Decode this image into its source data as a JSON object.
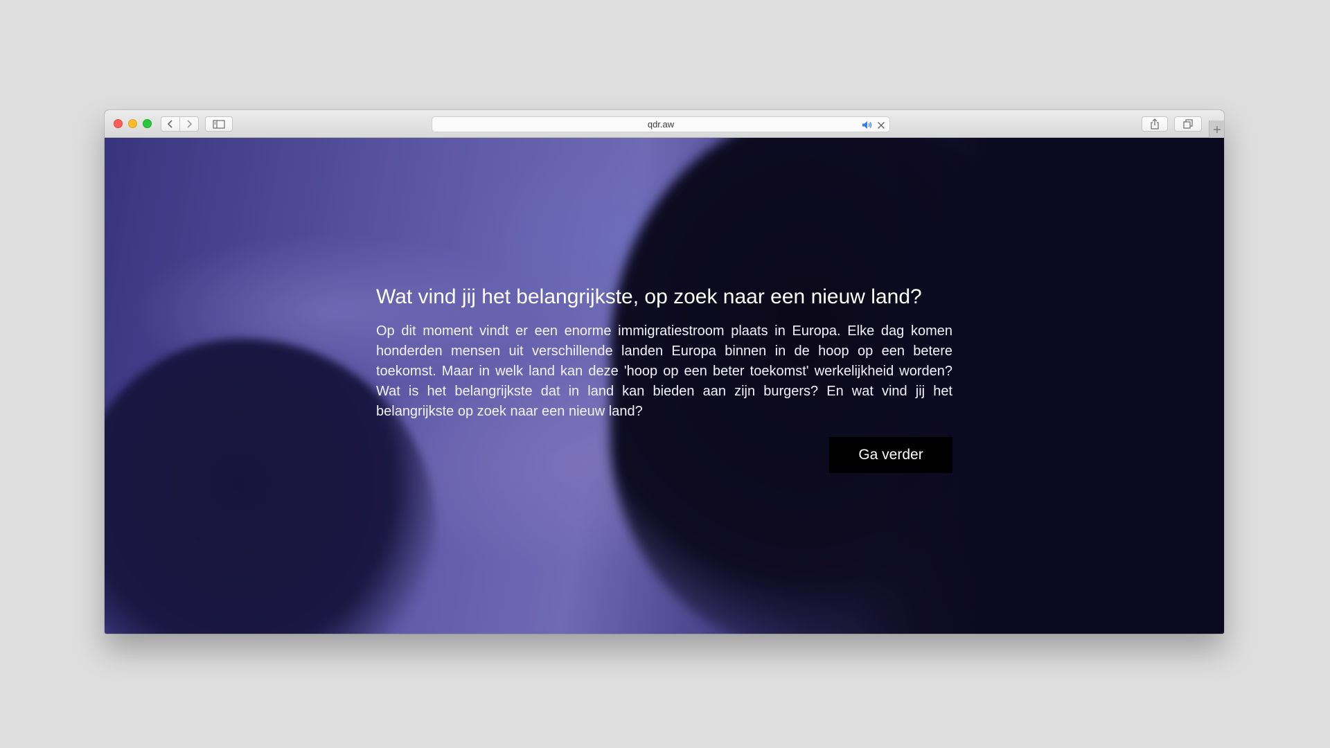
{
  "browser": {
    "address_bar": {
      "url": "qdr.aw"
    },
    "icons": {
      "back": "chevron-left-icon",
      "forward": "chevron-right-icon",
      "sidebar": "sidebar-icon",
      "audio": "speaker-icon",
      "stop": "close-icon",
      "share": "share-icon",
      "tabs": "tabs-overview-icon",
      "new_tab": "plus-icon"
    },
    "colors": {
      "close": "#fc5f57",
      "minimize": "#fdbc2e",
      "maximize": "#28c940",
      "audio_icon": "#2f7cf6"
    }
  },
  "page": {
    "headline": "Wat vind jij het belangrijkste, op zoek naar een nieuw land?",
    "body": "Op dit moment vindt er een enorme immigratiestroom plaats in Europa. Elke dag komen honderden mensen uit verschillende landen Europa binnen in de hoop op een betere toekomst. Maar in welk land kan deze 'hoop op een beter toekomst' werkelijkheid worden? Wat is het belangrijkste dat in land kan bieden aan zijn burgers? En wat vind jij het belangrijkste op zoek naar een nieuw land?",
    "continue_label": "Ga verder",
    "colors": {
      "button_bg": "#000000",
      "text": "#ffffff"
    }
  }
}
